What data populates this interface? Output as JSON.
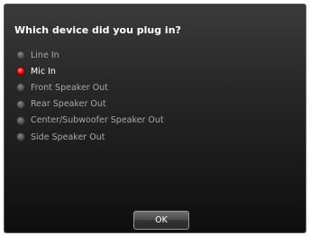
{
  "dialog": {
    "title": "Which device did you plug in?",
    "options": [
      {
        "label": "Line In",
        "selected": false
      },
      {
        "label": "Mic In",
        "selected": true
      },
      {
        "label": "Front Speaker Out",
        "selected": false
      },
      {
        "label": "Rear Speaker Out",
        "selected": false
      },
      {
        "label": "Center/Subwoofer Speaker Out",
        "selected": false
      },
      {
        "label": "Side Speaker Out",
        "selected": false
      }
    ],
    "ok_label": "OK"
  },
  "colors": {
    "selected_radio": "#e01818",
    "unselected_radio": "#5a5a5a",
    "title_text": "#ffffff",
    "option_text": "#a9a9a9"
  },
  "icons": {
    "selected_radio": "radio-selected-icon",
    "unselected_radio": "radio-unselected-icon"
  }
}
